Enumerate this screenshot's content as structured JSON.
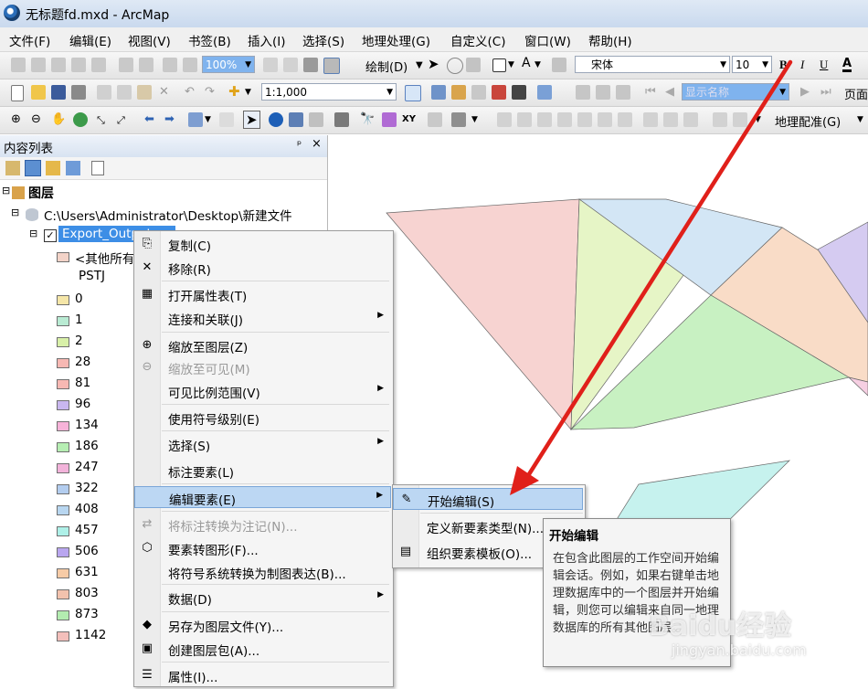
{
  "window": {
    "title": "无标题fd.mxd - ArcMap"
  },
  "menubar": [
    "文件(F)",
    "编辑(E)",
    "视图(V)",
    "书签(B)",
    "插入(I)",
    "选择(S)",
    "地理处理(G)",
    "自定义(C)",
    "窗口(W)",
    "帮助(H)"
  ],
  "toolbar1": {
    "zoom": "100%",
    "draw_label": "绘制(D)",
    "font_name": "宋体",
    "font_size": "10",
    "bold": "B",
    "italic": "I",
    "underline": "U",
    "font_color": "A"
  },
  "toolbar2": {
    "scale": "1:1,000",
    "layout_label": "显示名称",
    "page_label": "页面"
  },
  "toolbar3": {
    "georef_label": "地理配准(G)"
  },
  "toc": {
    "title": "内容列表",
    "pin": "ᵖ",
    "close": "×",
    "root_label": "图层",
    "datasource": "C:\\Users\\Administrator\\Desktop\\新建文件",
    "layer_name": "Export_Output",
    "legend_other": "<其他所有值>",
    "field_name": "PSTJ",
    "legend": [
      {
        "label": "0",
        "color": "#f5e6a8"
      },
      {
        "label": "1",
        "color": "#b9ebd3"
      },
      {
        "label": "2",
        "color": "#d8f0a8"
      },
      {
        "label": "28",
        "color": "#f7b8b3"
      },
      {
        "label": "81",
        "color": "#f7b8b3"
      },
      {
        "label": "96",
        "color": "#c9b7ef"
      },
      {
        "label": "134",
        "color": "#f7b3d9"
      },
      {
        "label": "186",
        "color": "#b6eeb3"
      },
      {
        "label": "247",
        "color": "#f2b3da"
      },
      {
        "label": "322",
        "color": "#b3cdef"
      },
      {
        "label": "408",
        "color": "#b8d6f0"
      },
      {
        "label": "457",
        "color": "#aef0e8"
      },
      {
        "label": "506",
        "color": "#b9a6ef"
      },
      {
        "label": "631",
        "color": "#f6cba6"
      },
      {
        "label": "803",
        "color": "#f2c2ad"
      },
      {
        "label": "873",
        "color": "#b3ecb0"
      },
      {
        "label": "1142",
        "color": "#f3bfbb"
      }
    ]
  },
  "context_menu": [
    {
      "label": "复制(C)",
      "icon": "copy-icon",
      "glyph": "⎘"
    },
    {
      "label": "移除(R)",
      "icon": "remove-icon",
      "glyph": "✕"
    },
    {
      "label": "打开属性表(T)",
      "icon": "table-icon",
      "glyph": "▦"
    },
    {
      "label": "连接和关联(J)",
      "icon": "",
      "glyph": "",
      "submenu": true
    },
    {
      "label": "缩放至图层(Z)",
      "icon": "zoom-layer-icon",
      "glyph": "⊕"
    },
    {
      "label": "缩放至可见(M)",
      "icon": "zoom-visible-icon",
      "glyph": "⊖",
      "disabled": true
    },
    {
      "label": "可见比例范围(V)",
      "icon": "",
      "glyph": "",
      "submenu": true
    },
    {
      "label": "使用符号级别(E)",
      "icon": "",
      "glyph": ""
    },
    {
      "label": "选择(S)",
      "icon": "",
      "glyph": "",
      "submenu": true
    },
    {
      "label": "标注要素(L)",
      "icon": "",
      "glyph": ""
    },
    {
      "label": "编辑要素(E)",
      "icon": "",
      "glyph": "",
      "submenu": true,
      "highlight": true
    },
    {
      "label": "将标注转换为注记(N)...",
      "icon": "convert-labels-icon",
      "glyph": "⇄",
      "disabled": true
    },
    {
      "label": "要素转图形(F)...",
      "icon": "features-graphics-icon",
      "glyph": "⬡"
    },
    {
      "label": "将符号系统转换为制图表达(B)...",
      "icon": "",
      "glyph": ""
    },
    {
      "label": "数据(D)",
      "icon": "",
      "glyph": "",
      "submenu": true
    },
    {
      "label": "另存为图层文件(Y)...",
      "icon": "layer-file-icon",
      "glyph": "◆"
    },
    {
      "label": "创建图层包(A)...",
      "icon": "layer-package-icon",
      "glyph": "▣"
    },
    {
      "label": "属性(I)...",
      "icon": "properties-icon",
      "glyph": "☰"
    }
  ],
  "submenu": [
    {
      "label": "开始编辑(S)",
      "icon": "pencil-icon",
      "glyph": "✎",
      "highlight": true
    },
    {
      "label": "定义新要素类型(N)...",
      "icon": "",
      "glyph": ""
    },
    {
      "label": "组织要素模板(O)...",
      "icon": "templates-icon",
      "glyph": "▤"
    }
  ],
  "tooltip": {
    "title": "开始编辑",
    "body": "在包含此图层的工作空间开始编辑会话。例如，如果右键单击地理数据库中的一个图层并开始编辑，则您可以编辑来自同一地理数据库的所有其他图层。"
  },
  "watermark": {
    "brand": "Baidu经验",
    "url": "jingyan.baidu.com"
  },
  "colors": {
    "highlight": "#bcd7f3",
    "arrow": "#e0201a",
    "selection": "#3d8ee6"
  }
}
